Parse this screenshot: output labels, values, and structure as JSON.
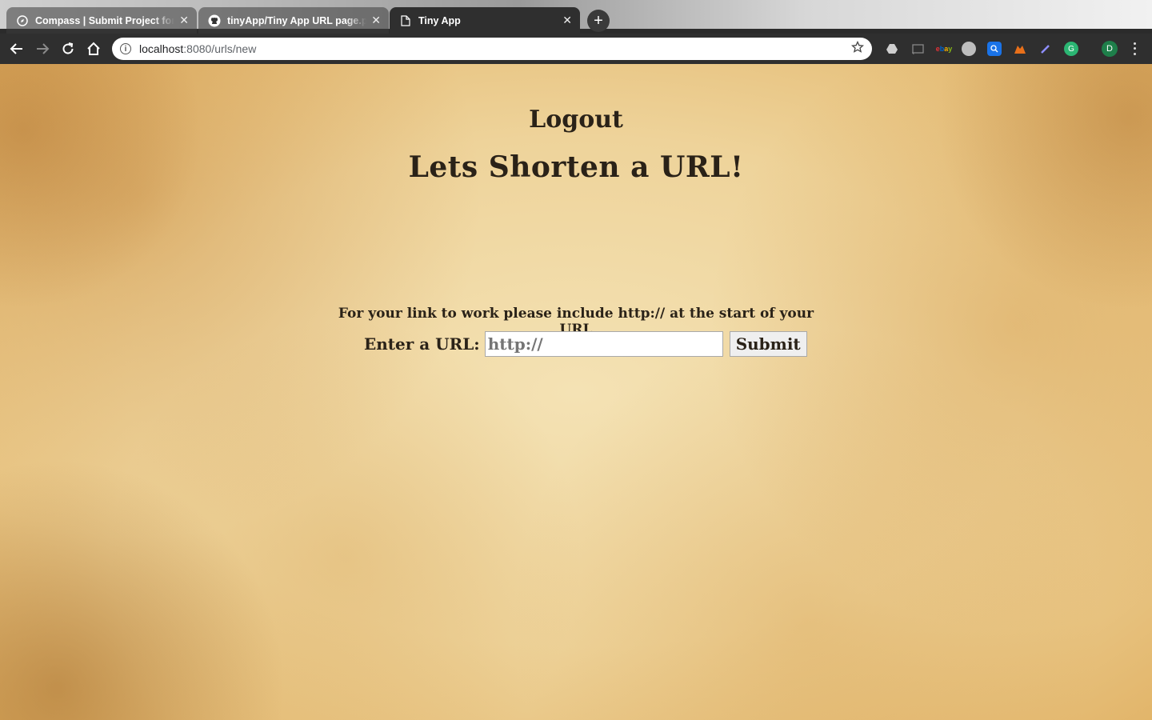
{
  "browser": {
    "tabs": [
      {
        "title": "Compass | Submit Project for Evaluation",
        "icon": "compass-icon",
        "active": false
      },
      {
        "title": "tinyApp/Tiny App URL page.png",
        "icon": "github-icon",
        "active": false
      },
      {
        "title": "Tiny App",
        "icon": "document-icon",
        "active": true
      }
    ],
    "address": {
      "host": "localhost",
      "path": ":8080/urls/new"
    },
    "profile_initial": "D"
  },
  "page": {
    "logout_label": "Logout",
    "heading": "Lets Shorten a URL!",
    "hint": "For your link to work please include http:// at the start of your URL",
    "form": {
      "label": "Enter a URL:",
      "input_placeholder": "http://",
      "submit_label": "Submit"
    }
  },
  "colors": {
    "text": "#2a2218",
    "parchment": "#eed39a",
    "toolbar": "#2f2f2f"
  }
}
